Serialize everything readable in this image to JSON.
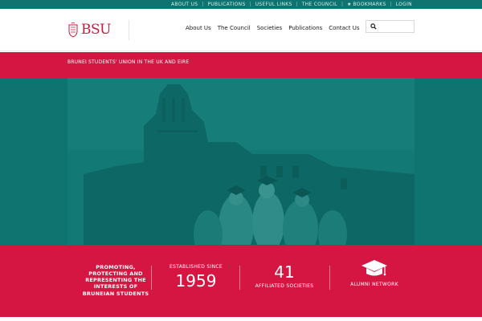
{
  "topbar": {
    "links": [
      "ABOUT US",
      "PUBLICATIONS",
      "USEFUL LINKS",
      "THE COUNCIL",
      "BOOKMARKS",
      "LOGIN"
    ]
  },
  "header": {
    "logo_text": "BSU",
    "nav": [
      "About Us",
      "The Council",
      "Societies",
      "Publications",
      "Contact Us"
    ],
    "search_placeholder": ""
  },
  "tagline": "BRUNEI STUDENTS' UNION IN THE UK AND EIRE",
  "stats": {
    "mission": "PROMOTING, PROTECTING AND REPRESENTING THE INTERESTS OF BRUNEIAN STUDENTS",
    "established_label": "ESTABLISHED SINCE",
    "established_year": "1959",
    "societies_count": "41",
    "societies_label": "AFFILIATED SOCIETIES",
    "alumni_label": "ALUMNI NETWORK"
  },
  "colors": {
    "teal": "#0f7470",
    "crimson": "#d51642"
  },
  "icons": [
    "crest-logo",
    "search-icon",
    "star-icon",
    "graduation-cap-icon"
  ]
}
